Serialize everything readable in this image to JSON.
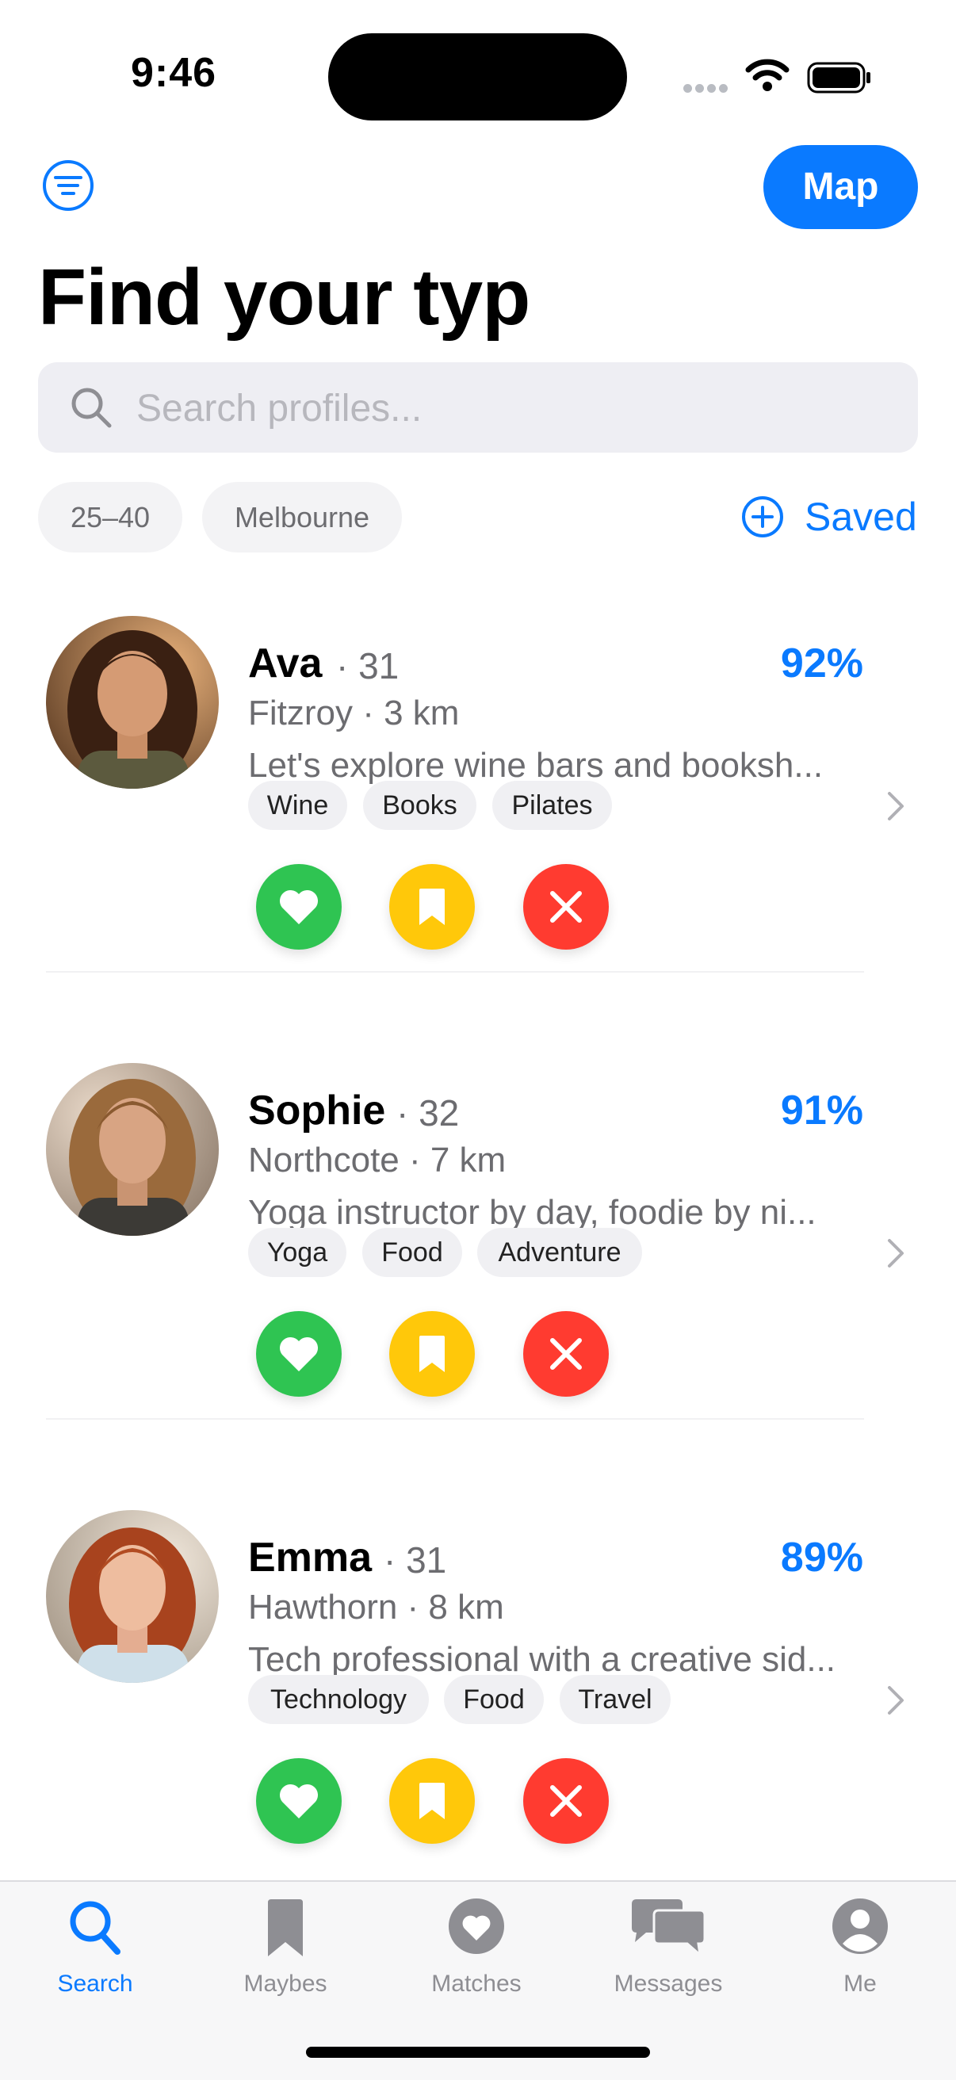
{
  "status": {
    "time": "9:46"
  },
  "header": {
    "map_label": "Map",
    "title": "Find your typ"
  },
  "search": {
    "placeholder": "Search profiles..."
  },
  "filters": {
    "age_range": "25–40",
    "location": "Melbourne",
    "saved_label": "Saved"
  },
  "colors": {
    "accent": "#0a7aff",
    "like": "#2fc452",
    "maybe": "#ffc80a",
    "pass": "#ff3b30"
  },
  "profiles": [
    {
      "name": "Ava",
      "age": "· 31",
      "match": "92%",
      "location": "Fitzroy · 3 km",
      "bio": "Let's explore wine bars and booksh...",
      "tags": [
        "Wine",
        "Books",
        "Pilates"
      ]
    },
    {
      "name": "Sophie",
      "age": "· 32",
      "match": "91%",
      "location": "Northcote · 7 km",
      "bio": "Yoga instructor by day, foodie by ni...",
      "tags": [
        "Yoga",
        "Food",
        "Adventure"
      ]
    },
    {
      "name": "Emma",
      "age": "· 31",
      "match": "89%",
      "location": "Hawthorn · 8 km",
      "bio": "Tech professional with a creative sid...",
      "tags": [
        "Technology",
        "Food",
        "Travel"
      ]
    }
  ],
  "tabs": [
    {
      "label": "Search",
      "icon": "search-icon",
      "active": true
    },
    {
      "label": "Maybes",
      "icon": "bookmark-icon",
      "active": false
    },
    {
      "label": "Matches",
      "icon": "heart-icon",
      "active": false
    },
    {
      "label": "Messages",
      "icon": "chat-bubbles-icon",
      "active": false
    },
    {
      "label": "Me",
      "icon": "person-icon",
      "active": false
    }
  ]
}
